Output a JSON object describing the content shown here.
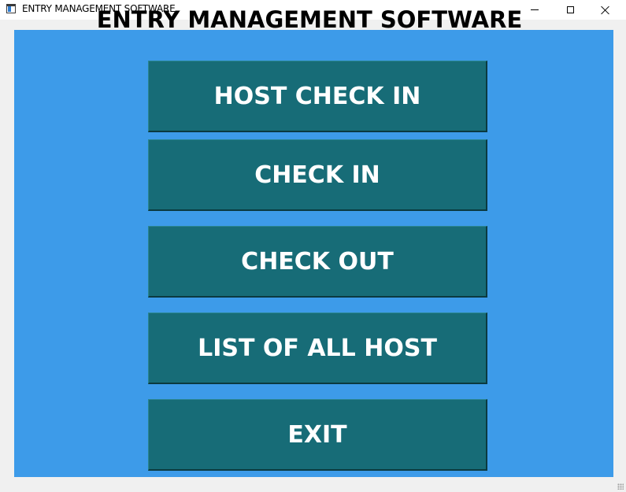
{
  "window": {
    "title": "ENTRY MANAGEMENT SOFTWARE",
    "icon": "app-window-icon"
  },
  "controls": {
    "minimize": "minimize-icon",
    "maximize": "maximize-icon",
    "close": "close-icon"
  },
  "main": {
    "heading": "ENTRY MANAGEMENT SOFTWARE",
    "background_color": "#3d9be9",
    "button_color": "#176c77",
    "buttons": [
      {
        "label": "HOST CHECK IN"
      },
      {
        "label": "CHECK IN"
      },
      {
        "label": "CHECK OUT"
      },
      {
        "label": "LIST OF ALL HOST"
      },
      {
        "label": "EXIT"
      }
    ]
  }
}
